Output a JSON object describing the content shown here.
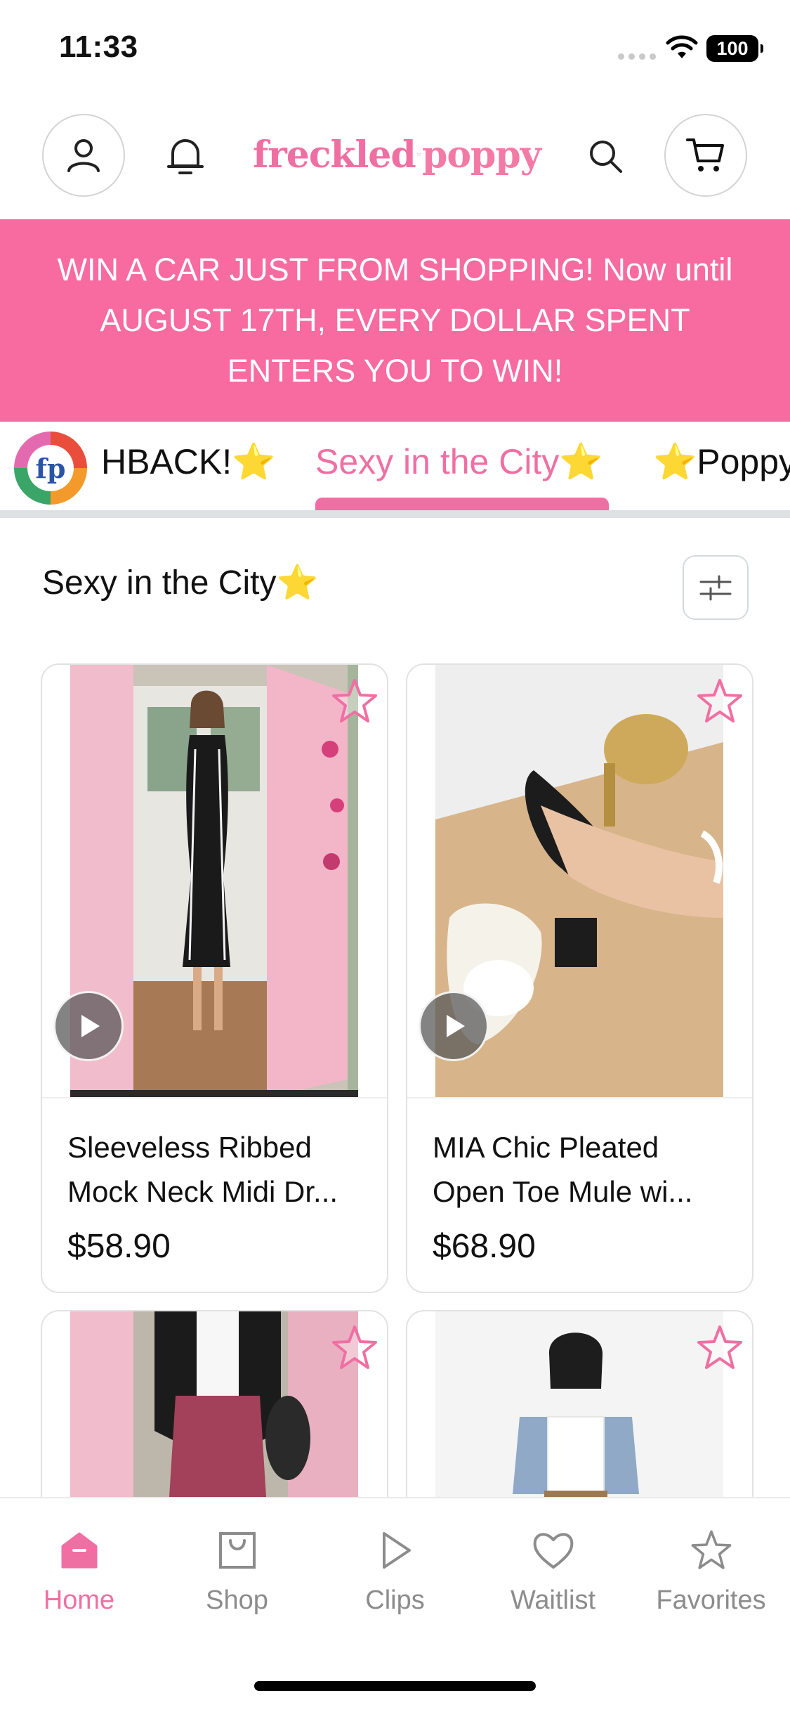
{
  "status_bar": {
    "time": "11:33",
    "battery": "100"
  },
  "header": {
    "logo_word_1": "freckled",
    "logo_word_2": "poppy"
  },
  "promo": {
    "text": "WIN A CAR JUST FROM SHOPPING! Now until AUGUST 17TH, EVERY DOLLAR SPENT ENTERS YOU TO WIN!"
  },
  "collection_tabs": {
    "badge_text": "fp",
    "items": [
      {
        "label": "HBACK!⭐"
      },
      {
        "label": "Sexy in the City⭐",
        "active": true
      },
      {
        "label": "⭐Poppy"
      }
    ]
  },
  "section": {
    "title": "Sexy in the City⭐"
  },
  "products": [
    {
      "name_line_1": "Sleeveless Ribbed",
      "name_line_2": "Mock Neck Midi Dr...",
      "price": "$58.90",
      "has_video": true
    },
    {
      "name_line_1": "MIA Chic Pleated",
      "name_line_2": "Open Toe Mule wi...",
      "price": "$68.90",
      "has_video": true
    },
    {
      "name_line_1": "",
      "name_line_2": "",
      "price": "",
      "has_video": false
    },
    {
      "name_line_1": "",
      "name_line_2": "",
      "price": "",
      "has_video": false
    }
  ],
  "bottom_nav": {
    "items": [
      {
        "label": "Home",
        "icon": "home-icon",
        "active": true
      },
      {
        "label": "Shop",
        "icon": "bag-icon"
      },
      {
        "label": "Clips",
        "icon": "play-icon"
      },
      {
        "label": "Waitlist",
        "icon": "heart-icon"
      },
      {
        "label": "Favorites",
        "icon": "star-icon"
      }
    ]
  },
  "colors": {
    "accent_pink": "#f06fa3",
    "promo_bg": "#f76ba1",
    "inactive_gray": "#8c8c8c"
  }
}
